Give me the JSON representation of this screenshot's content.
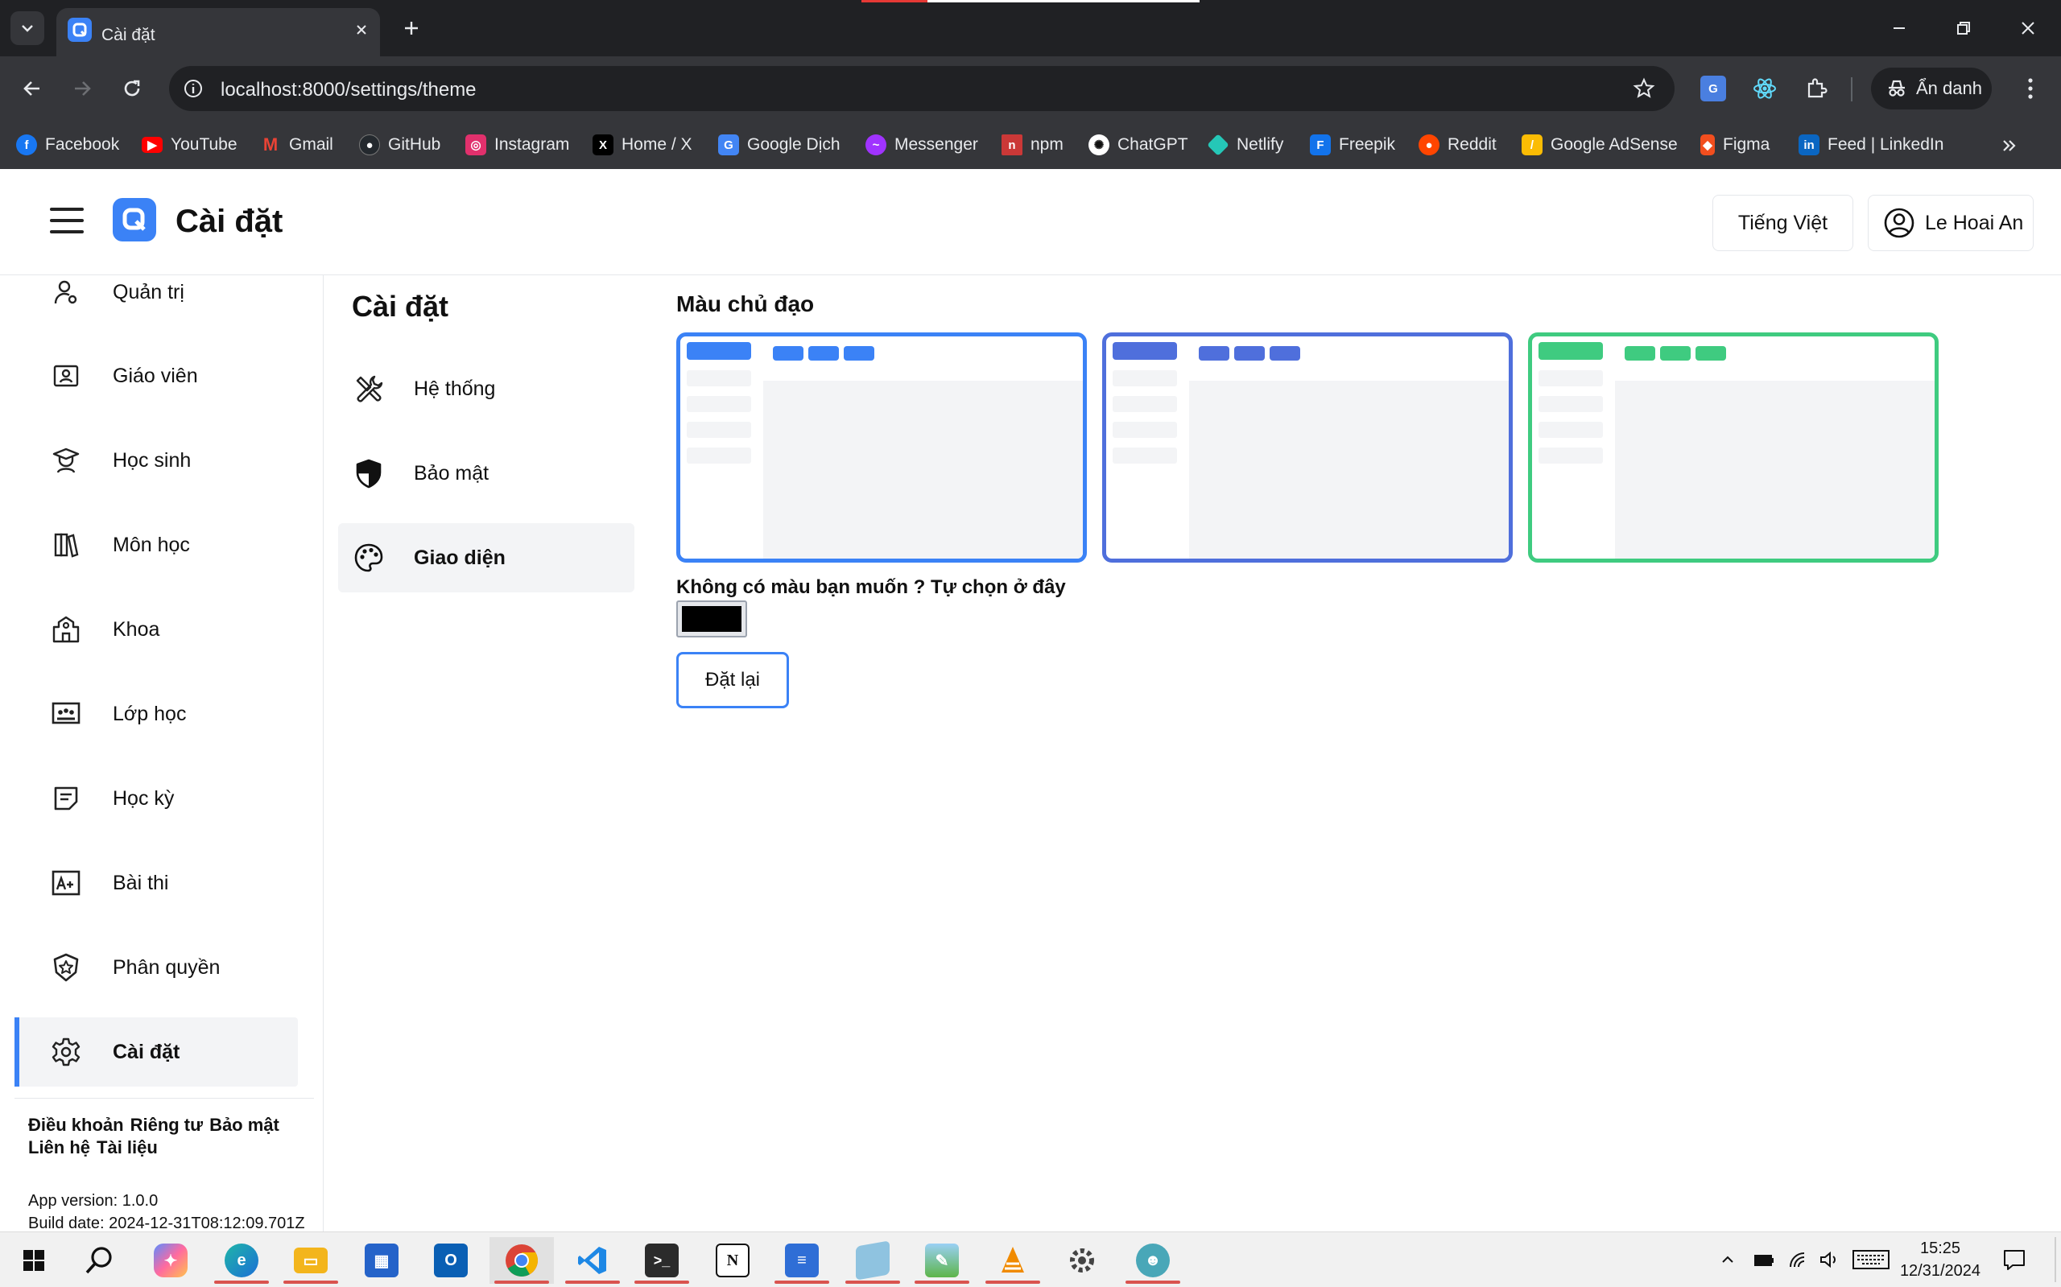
{
  "browser": {
    "tab_title": "Cài đặt",
    "url": "localhost:8000/settings/theme",
    "incognito_label": "Ẩn danh"
  },
  "bookmarks": [
    {
      "label": "Facebook",
      "icon": "facebook-icon",
      "color": "#1877f2"
    },
    {
      "label": "YouTube",
      "icon": "youtube-icon",
      "color": "#ff0000"
    },
    {
      "label": "Gmail",
      "icon": "gmail-icon",
      "color": "#ea4335"
    },
    {
      "label": "GitHub",
      "icon": "github-icon",
      "color": "#24292e"
    },
    {
      "label": "Instagram",
      "icon": "instagram-icon",
      "color": "#e1306c"
    },
    {
      "label": "Home / X",
      "icon": "x-icon",
      "color": "#000000"
    },
    {
      "label": "Google Dịch",
      "icon": "google-translate-icon",
      "color": "#4285f4"
    },
    {
      "label": "Messenger",
      "icon": "messenger-icon",
      "color": "#a033ff"
    },
    {
      "label": "npm",
      "icon": "npm-icon",
      "color": "#cb3837"
    },
    {
      "label": "ChatGPT",
      "icon": "chatgpt-icon",
      "color": "#ffffff"
    },
    {
      "label": "Netlify",
      "icon": "netlify-icon",
      "color": "#25c7b7"
    },
    {
      "label": "Freepik",
      "icon": "freepik-icon",
      "color": "#1273eb"
    },
    {
      "label": "Reddit",
      "icon": "reddit-icon",
      "color": "#ff4500"
    },
    {
      "label": "Google AdSense",
      "icon": "adsense-icon",
      "color": "#fbbc04"
    },
    {
      "label": "Figma",
      "icon": "figma-icon",
      "color": "#f24e1e"
    },
    {
      "label": "Feed | LinkedIn",
      "icon": "linkedin-icon",
      "color": "#0a66c2"
    }
  ],
  "header": {
    "title": "Cài đặt",
    "language": "Tiếng Việt",
    "user_name": "Le Hoai An"
  },
  "sidebar": {
    "items": [
      {
        "label": "Quản trị",
        "icon": "admin-icon"
      },
      {
        "label": "Giáo viên",
        "icon": "teacher-icon"
      },
      {
        "label": "Học sinh",
        "icon": "student-icon"
      },
      {
        "label": "Môn học",
        "icon": "subject-icon"
      },
      {
        "label": "Khoa",
        "icon": "faculty-icon"
      },
      {
        "label": "Lớp học",
        "icon": "class-icon"
      },
      {
        "label": "Học kỳ",
        "icon": "semester-icon"
      },
      {
        "label": "Bài thi",
        "icon": "exam-icon"
      },
      {
        "label": "Phân quyền",
        "icon": "permission-icon"
      },
      {
        "label": "Cài đặt",
        "icon": "settings-icon",
        "active": true
      }
    ],
    "footer_links": [
      "Điều khoản",
      "Riêng tư",
      "Bảo mật",
      "Liên hệ",
      "Tài liệu"
    ],
    "app_version": "App version: 1.0.0",
    "build_date": "Build date: 2024-12-31T08:12:09.701Z"
  },
  "settings_nav": {
    "title": "Cài đặt",
    "items": [
      {
        "label": "Hệ thống",
        "icon": "tools-icon"
      },
      {
        "label": "Bảo mật",
        "icon": "shield-icon"
      },
      {
        "label": "Giao diện",
        "icon": "palette-icon",
        "active": true
      }
    ]
  },
  "theme": {
    "section_title": "Màu chủ đạo",
    "options": [
      {
        "color": "#3b82f6"
      },
      {
        "color": "#4f6fdc"
      },
      {
        "color": "#3fcb80"
      }
    ],
    "custom_label": "Không có màu bạn muốn ? Tự chọn ở đây",
    "custom_color": "#000000",
    "reset_label": "Đặt lại"
  },
  "taskbar": {
    "time": "15:25",
    "date": "12/31/2024"
  }
}
